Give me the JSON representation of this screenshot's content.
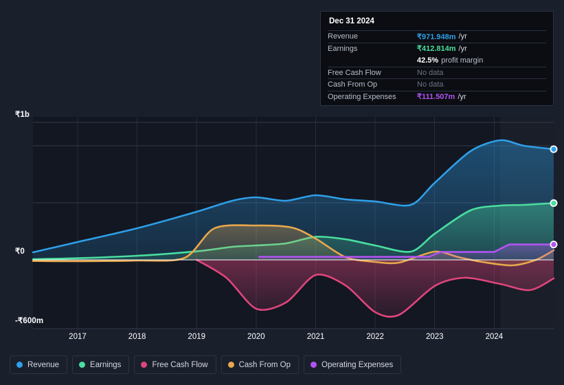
{
  "tooltip": {
    "title": "Dec 31 2024",
    "rows": [
      {
        "label": "Revenue",
        "value": "₹971.948m",
        "unit": "/yr",
        "color": "#2f9fe8",
        "no_data": false
      },
      {
        "label": "Earnings",
        "value": "₹412.814m",
        "unit": "/yr",
        "color": "#4ade9f",
        "no_data": false
      },
      {
        "label": "",
        "value": "42.5%",
        "unit": "profit margin",
        "color": "#ffffff",
        "no_data": false,
        "is_margin": true
      },
      {
        "label": "Free Cash Flow",
        "value": "No data",
        "unit": "",
        "color": "#6d7484",
        "no_data": true
      },
      {
        "label": "Cash From Op",
        "value": "No data",
        "unit": "",
        "color": "#6d7484",
        "no_data": true
      },
      {
        "label": "Operating Expenses",
        "value": "₹111.507m",
        "unit": "/yr",
        "color": "#b253f0",
        "no_data": false
      }
    ]
  },
  "legend": {
    "items": [
      {
        "label": "Revenue",
        "color": "#2f9fe8"
      },
      {
        "label": "Earnings",
        "color": "#4ade9f"
      },
      {
        "label": "Free Cash Flow",
        "color": "#e0457b"
      },
      {
        "label": "Cash From Op",
        "color": "#e8a84c"
      },
      {
        "label": "Operating Expenses",
        "color": "#b253f0"
      }
    ]
  },
  "chart_data": {
    "type": "area",
    "title": "",
    "xlabel": "",
    "ylabel": "",
    "currency": "₹",
    "ylim": [
      -600000000,
      1000000000
    ],
    "ytick_labels": [
      "₹1b",
      "₹0",
      "-₹600m"
    ],
    "ytick_values": [
      1000000000,
      0,
      -600000000
    ],
    "xtick_labels": [
      "2017",
      "2018",
      "2019",
      "2020",
      "2021",
      "2022",
      "2023",
      "2024"
    ],
    "xtick_values": [
      2017,
      2018,
      2019,
      2020,
      2021,
      2022,
      2023,
      2024
    ],
    "grid": true,
    "legend_position": "bottom",
    "zero_line": true,
    "forecast_start_x": 2024.1,
    "series": [
      {
        "name": "Revenue",
        "color": "#2f9fe8",
        "fill": true,
        "end_marker": true,
        "points": [
          [
            2016.25,
            55
          ],
          [
            2017,
            130
          ],
          [
            2018,
            230
          ],
          [
            2019,
            350
          ],
          [
            2019.6,
            430
          ],
          [
            2020,
            455
          ],
          [
            2020.5,
            430
          ],
          [
            2021,
            470
          ],
          [
            2021.5,
            440
          ],
          [
            2022,
            425
          ],
          [
            2022.6,
            400
          ],
          [
            2023,
            560
          ],
          [
            2023.6,
            790
          ],
          [
            2024.1,
            870
          ],
          [
            2024.5,
            830
          ],
          [
            2025.0,
            805
          ]
        ]
      },
      {
        "name": "Earnings",
        "color": "#4ade9f",
        "fill": true,
        "end_marker": true,
        "points": [
          [
            2016.25,
            5
          ],
          [
            2017,
            12
          ],
          [
            2018,
            30
          ],
          [
            2019,
            62
          ],
          [
            2019.6,
            95
          ],
          [
            2020,
            105
          ],
          [
            2020.5,
            120
          ],
          [
            2021,
            168
          ],
          [
            2021.5,
            150
          ],
          [
            2022,
            105
          ],
          [
            2022.6,
            60
          ],
          [
            2023,
            190
          ],
          [
            2023.6,
            360
          ],
          [
            2024.1,
            395
          ],
          [
            2024.5,
            400
          ],
          [
            2025.0,
            413
          ]
        ]
      },
      {
        "name": "Free Cash Flow",
        "color": "#e0457b",
        "fill": true,
        "end_marker": false,
        "points": [
          [
            2019.0,
            0
          ],
          [
            2019.5,
            -130
          ],
          [
            2020.0,
            -355
          ],
          [
            2020.5,
            -310
          ],
          [
            2021.0,
            -110
          ],
          [
            2021.5,
            -185
          ],
          [
            2022.0,
            -380
          ],
          [
            2022.4,
            -400
          ],
          [
            2023.0,
            -190
          ],
          [
            2023.5,
            -130
          ],
          [
            2024.1,
            -175
          ],
          [
            2024.6,
            -220
          ],
          [
            2025.0,
            -135
          ]
        ]
      },
      {
        "name": "Cash From Op",
        "color": "#e8a84c",
        "fill": true,
        "end_marker": false,
        "points": [
          [
            2016.25,
            -8
          ],
          [
            2017,
            -10
          ],
          [
            2018,
            -5
          ],
          [
            2018.8,
            15
          ],
          [
            2019.3,
            230
          ],
          [
            2020,
            250
          ],
          [
            2020.6,
            235
          ],
          [
            2021,
            155
          ],
          [
            2021.5,
            20
          ],
          [
            2022,
            -15
          ],
          [
            2022.4,
            -20
          ],
          [
            2023,
            60
          ],
          [
            2023.4,
            20
          ],
          [
            2023.8,
            -15
          ],
          [
            2024.3,
            -40
          ],
          [
            2024.7,
            0
          ],
          [
            2025.0,
            70
          ]
        ]
      },
      {
        "name": "Operating Expenses",
        "color": "#b253f0",
        "fill": true,
        "end_marker": true,
        "points": [
          [
            2020.05,
            22
          ],
          [
            2022.9,
            22
          ],
          [
            2023.1,
            58
          ],
          [
            2024.0,
            58
          ],
          [
            2024.25,
            112
          ],
          [
            2025.0,
            112
          ]
        ]
      }
    ]
  }
}
